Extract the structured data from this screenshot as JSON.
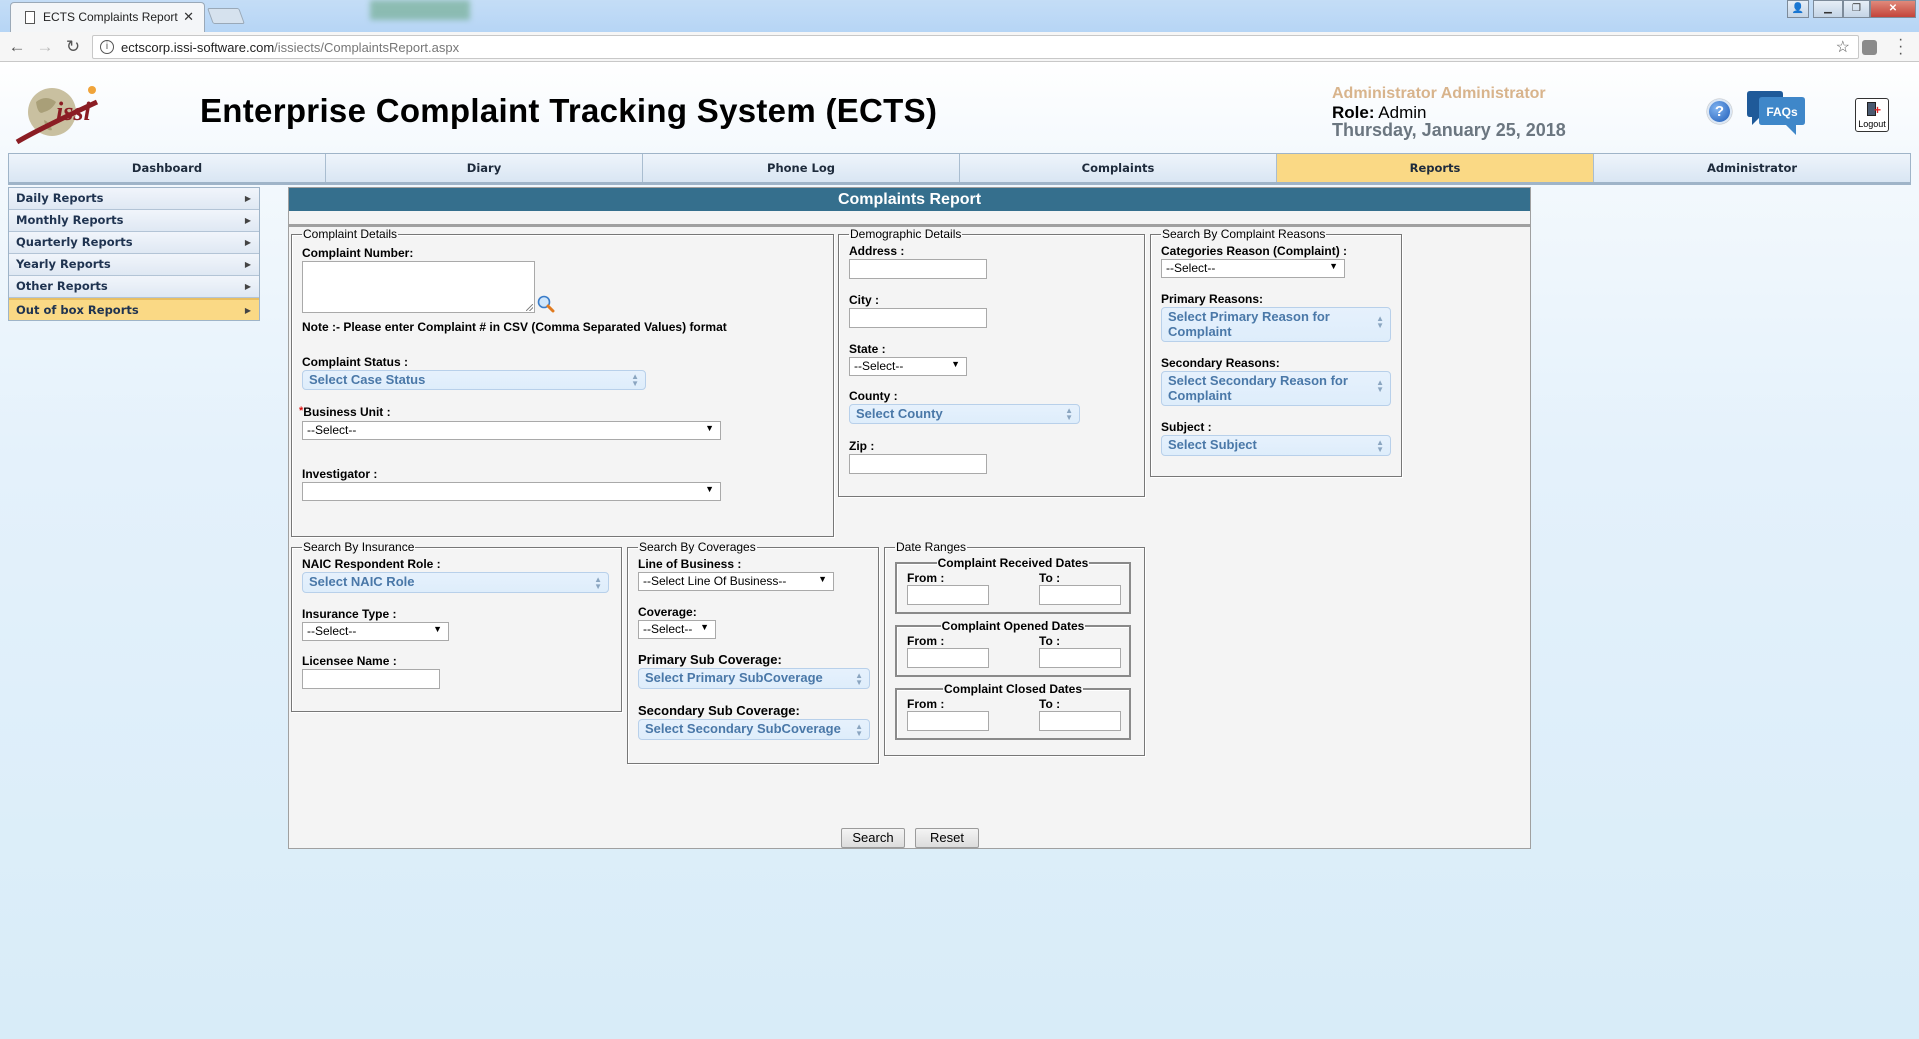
{
  "browser": {
    "tab_title": "ECTS Complaints Report",
    "url_host": "ectscorp.issi-software.com",
    "url_path": "/issiects/ComplaintsReport.aspx"
  },
  "header": {
    "logo_text": "issi",
    "app_title": "Enterprise Complaint Tracking System (ECTS)",
    "user_name": "Administrator Administrator",
    "role_label": "Role:",
    "role_value": " Admin",
    "date": "Thursday, January 25, 2018",
    "faq_label": "FAQs",
    "logout_label": "Logout",
    "help_glyph": "?"
  },
  "nav": {
    "tabs": [
      {
        "label": "Dashboard",
        "active": false
      },
      {
        "label": "Diary",
        "active": false
      },
      {
        "label": "Phone Log",
        "active": false
      },
      {
        "label": "Complaints",
        "active": false
      },
      {
        "label": "Reports",
        "active": true
      },
      {
        "label": "Administrator",
        "active": false
      }
    ],
    "active_color": "#fad985"
  },
  "sidebar": {
    "items": [
      {
        "label": "Daily Reports"
      },
      {
        "label": "Monthly Reports"
      },
      {
        "label": "Quarterly Reports"
      },
      {
        "label": "Yearly Reports"
      },
      {
        "label": "Other Reports"
      },
      {
        "label": "Out of box Reports",
        "active": true
      }
    ]
  },
  "panel": {
    "title": "Complaints Report",
    "title_bg": "#356f8d"
  },
  "complaint_details": {
    "legend": "Complaint Details",
    "complaint_number_label": "Complaint Number:",
    "complaint_number_value": "",
    "note": "Note :- Please enter Complaint # in CSV (Comma Separated Values) format",
    "status_label": "Complaint Status :",
    "status_placeholder": "Select Case Status",
    "required_marker": "*",
    "business_unit_label": "Business Unit :",
    "business_unit_value": "--Select--",
    "investigator_label": "Investigator :",
    "investigator_value": ""
  },
  "demographic": {
    "legend": "Demographic Details",
    "address_label": "Address :",
    "address_value": "",
    "city_label": "City :",
    "city_value": "",
    "state_label": "State :",
    "state_value": "--Select--",
    "county_label": "County :",
    "county_placeholder": "Select County",
    "zip_label": "Zip :",
    "zip_value": ""
  },
  "complaint_reasons": {
    "legend": "Search By Complaint Reasons",
    "categories_label": "Categories Reason (Complaint) :",
    "categories_value": "--Select--",
    "primary_label": "Primary Reasons:",
    "primary_placeholder": "Select Primary Reason for Complaint",
    "secondary_label": "Secondary Reasons:",
    "secondary_placeholder": "Select Secondary Reason for Complaint",
    "subject_label": "Subject :",
    "subject_placeholder": "Select Subject"
  },
  "insurance": {
    "legend": "Search By Insurance",
    "naic_label": "NAIC Respondent Role :",
    "naic_placeholder": "Select NAIC Role",
    "type_label": "Insurance Type :",
    "type_value": "--Select--",
    "licensee_label": "Licensee Name :",
    "licensee_value": ""
  },
  "coverages": {
    "legend": "Search By Coverages",
    "lob_label": "Line of Business :",
    "lob_value": "--Select Line Of Business--",
    "coverage_label": "Coverage:",
    "coverage_value": "--Select--",
    "primary_sub_label": "Primary Sub Coverage:",
    "primary_sub_placeholder": "Select Primary SubCoverage",
    "secondary_sub_label": "Secondary Sub Coverage:",
    "secondary_sub_placeholder": "Select Secondary SubCoverage"
  },
  "date_ranges": {
    "legend": "Date Ranges",
    "from_label": "From :",
    "to_label": "To :",
    "groups": [
      {
        "legend": "Complaint Received Dates",
        "from": "",
        "to": ""
      },
      {
        "legend": "Complaint Opened Dates",
        "from": "",
        "to": ""
      },
      {
        "legend": "Complaint Closed Dates",
        "from": "",
        "to": ""
      }
    ]
  },
  "actions": {
    "search_label": "Search",
    "reset_label": "Reset"
  }
}
